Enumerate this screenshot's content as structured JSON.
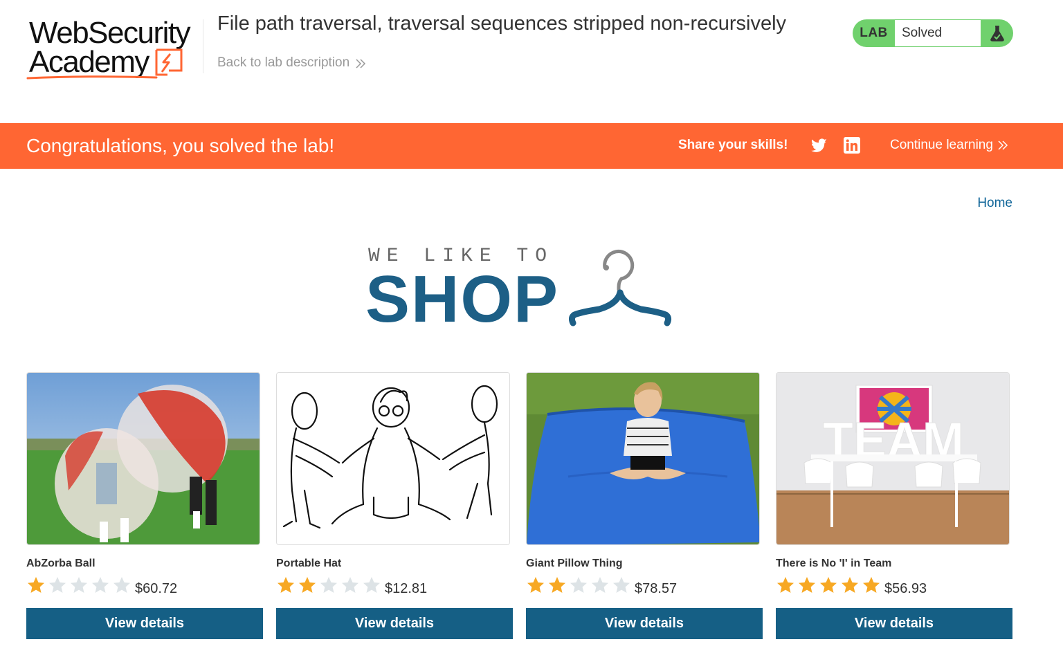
{
  "header": {
    "logo_line1": "WebSecurity",
    "logo_line2": "Academy",
    "lab_title": "File path traversal, traversal sequences stripped non-recursively",
    "back_link": "Back to lab description",
    "status": {
      "badge": "LAB",
      "text": "Solved"
    }
  },
  "banner": {
    "message": "Congratulations, you solved the lab!",
    "share_label": "Share your skills!",
    "continue_label": "Continue learning"
  },
  "nav": {
    "home": "Home"
  },
  "hero": {
    "small": "WE LIKE TO",
    "big": "SHOP"
  },
  "products": [
    {
      "name": "AbZorba Ball",
      "rating": 1,
      "price": "$60.72",
      "button": "View details"
    },
    {
      "name": "Portable Hat",
      "rating": 2,
      "price": "$12.81",
      "button": "View details"
    },
    {
      "name": "Giant Pillow Thing",
      "rating": 2,
      "price": "$78.57",
      "button": "View details"
    },
    {
      "name": "There is No 'I' in Team",
      "rating": 5,
      "price": "$56.93",
      "button": "View details"
    }
  ],
  "colors": {
    "brand_orange": "#ff6633",
    "button_blue": "#155f85",
    "link_blue": "#116699",
    "solved_green": "#70d16d",
    "star_gold": "#f7a823",
    "star_empty": "#dde3e6"
  }
}
